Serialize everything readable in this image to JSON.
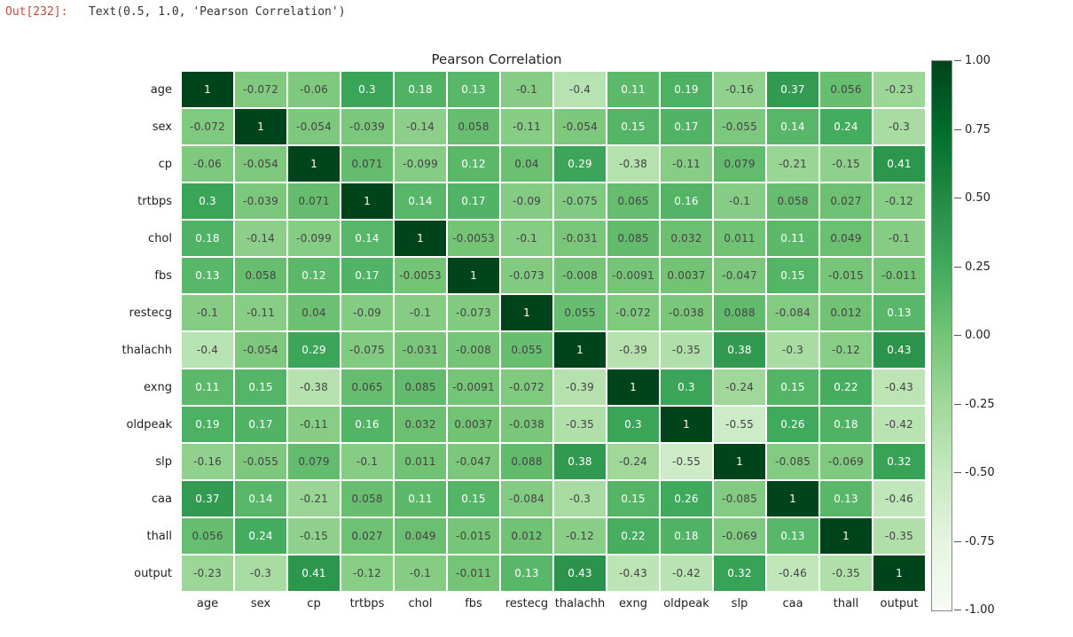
{
  "output_prompt_label": "Out[232]:",
  "output_prompt_body": "Text(0.5, 1.0, 'Pearson Correlation')",
  "chart_data": {
    "type": "heatmap",
    "title": "Pearson Correlation",
    "labels": [
      "age",
      "sex",
      "cp",
      "trtbps",
      "chol",
      "fbs",
      "restecg",
      "thalachh",
      "exng",
      "oldpeak",
      "slp",
      "caa",
      "thall",
      "output"
    ],
    "colorbar_ticks": [
      1.0,
      0.75,
      0.5,
      0.25,
      0.0,
      -0.25,
      -0.5,
      -0.75,
      -1.0
    ],
    "colorbar_tick_labels": [
      "1.00",
      "0.75",
      "0.50",
      "0.25",
      "0.00",
      "-0.25",
      "-0.50",
      "-0.75",
      "-1.00"
    ],
    "vmin": -1.0,
    "vmax": 1.0,
    "matrix": [
      [
        1,
        -0.072,
        -0.06,
        0.3,
        0.18,
        0.13,
        -0.1,
        -0.4,
        0.11,
        0.19,
        -0.16,
        0.37,
        0.056,
        -0.23
      ],
      [
        -0.072,
        1,
        -0.054,
        -0.039,
        -0.14,
        0.058,
        -0.11,
        -0.054,
        0.15,
        0.17,
        -0.055,
        0.14,
        0.24,
        -0.3
      ],
      [
        -0.06,
        -0.054,
        1,
        0.071,
        -0.099,
        0.12,
        0.04,
        0.29,
        -0.38,
        -0.11,
        0.079,
        -0.21,
        -0.15,
        0.41
      ],
      [
        0.3,
        -0.039,
        0.071,
        1,
        0.14,
        0.17,
        -0.09,
        -0.075,
        0.065,
        0.16,
        -0.1,
        0.058,
        0.027,
        -0.12
      ],
      [
        0.18,
        -0.14,
        -0.099,
        0.14,
        1,
        -0.0053,
        -0.1,
        -0.031,
        0.085,
        0.032,
        0.011,
        0.11,
        0.049,
        -0.1
      ],
      [
        0.13,
        0.058,
        0.12,
        0.17,
        -0.0053,
        1,
        -0.073,
        -0.008,
        -0.0091,
        0.0037,
        -0.047,
        0.15,
        -0.015,
        -0.011
      ],
      [
        -0.1,
        -0.11,
        0.04,
        -0.09,
        -0.1,
        -0.073,
        1,
        0.055,
        -0.072,
        -0.038,
        0.088,
        -0.084,
        0.012,
        0.13
      ],
      [
        -0.4,
        -0.054,
        0.29,
        -0.075,
        -0.031,
        -0.008,
        0.055,
        1,
        -0.39,
        -0.35,
        0.38,
        -0.3,
        -0.12,
        0.43
      ],
      [
        0.11,
        0.15,
        -0.38,
        0.065,
        0.085,
        -0.0091,
        -0.072,
        -0.39,
        1,
        0.3,
        -0.24,
        0.15,
        0.22,
        -0.43
      ],
      [
        0.19,
        0.17,
        -0.11,
        0.16,
        0.032,
        0.0037,
        -0.038,
        -0.35,
        0.3,
        1,
        -0.55,
        0.26,
        0.18,
        -0.42
      ],
      [
        -0.16,
        -0.055,
        0.079,
        -0.1,
        0.011,
        -0.047,
        0.088,
        0.38,
        -0.24,
        -0.55,
        1,
        -0.085,
        -0.069,
        0.32
      ],
      [
        0.37,
        0.14,
        -0.21,
        0.058,
        0.11,
        0.15,
        -0.084,
        -0.3,
        0.15,
        0.26,
        -0.085,
        1,
        0.13,
        -0.46
      ],
      [
        0.056,
        0.24,
        -0.15,
        0.027,
        0.049,
        -0.015,
        0.012,
        -0.12,
        0.22,
        0.18,
        -0.069,
        0.13,
        1,
        -0.35
      ],
      [
        -0.23,
        -0.3,
        0.41,
        -0.12,
        -0.1,
        -0.011,
        0.13,
        0.43,
        -0.43,
        -0.42,
        0.32,
        -0.46,
        -0.35,
        1
      ]
    ]
  }
}
